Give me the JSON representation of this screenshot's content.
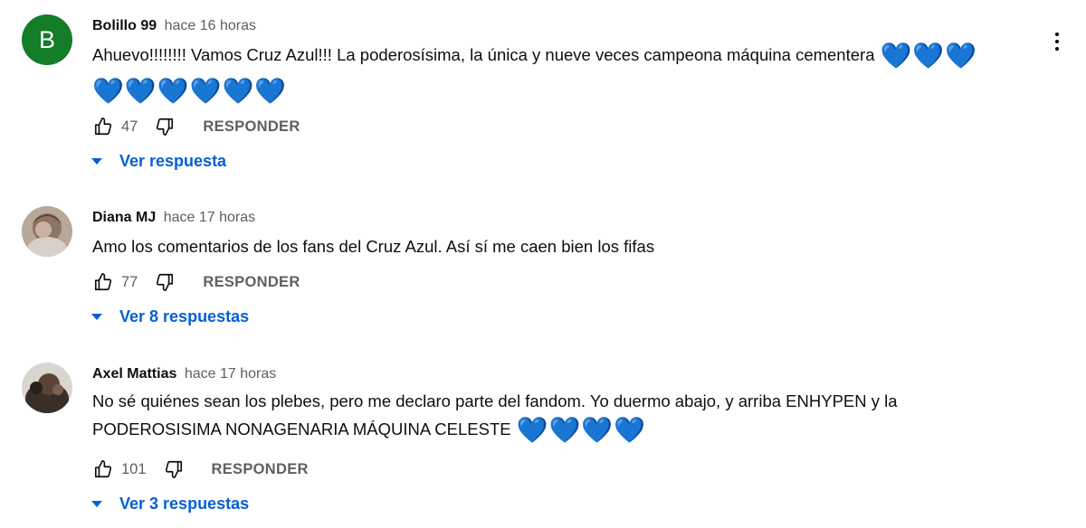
{
  "comments": [
    {
      "author": "Bolillo 99",
      "time": "hace 16 horas",
      "avatar_letter": "B",
      "text_line1": "Ahuevo!!!!!!!! Vamos Cruz Azul!!!  La poderosísima, la única y nueve veces campeona máquina cementera",
      "hearts_line1": "💙💙💙",
      "hearts_line2": "💙💙💙💙💙💙",
      "likes": "47",
      "reply_label": "RESPONDER",
      "replies_label": "Ver respuesta"
    },
    {
      "author": "Diana MJ",
      "time": "hace 17 horas",
      "text_line1": "Amo los comentarios de los fans del Cruz Azul. Así sí me caen bien los fifas",
      "likes": "77",
      "reply_label": "RESPONDER",
      "replies_label": "Ver 8 respuestas"
    },
    {
      "author": "Axel Mattias",
      "time": "hace 17 horas",
      "text_line1": "No sé quiénes sean los plebes, pero me declaro parte del fandom. Yo duermo abajo, y arriba ENHYPEN y la",
      "text_line2": "PODEROSISIMA NONAGENARIA MÁQUINA CELESTE",
      "hearts_line2": "💙💙💙💙",
      "likes": "101",
      "reply_label": "RESPONDER",
      "replies_label": "Ver 3 respuestas"
    }
  ],
  "icons": {
    "like": "thumb-up-outline",
    "dislike": "thumb-down-outline",
    "menu": "more-vertical",
    "expand": "caret-down"
  },
  "colors": {
    "accent": "#065fd4",
    "secondary_text": "#606060",
    "avatar_bg": "#137d27",
    "heart": "#1e90ff"
  }
}
